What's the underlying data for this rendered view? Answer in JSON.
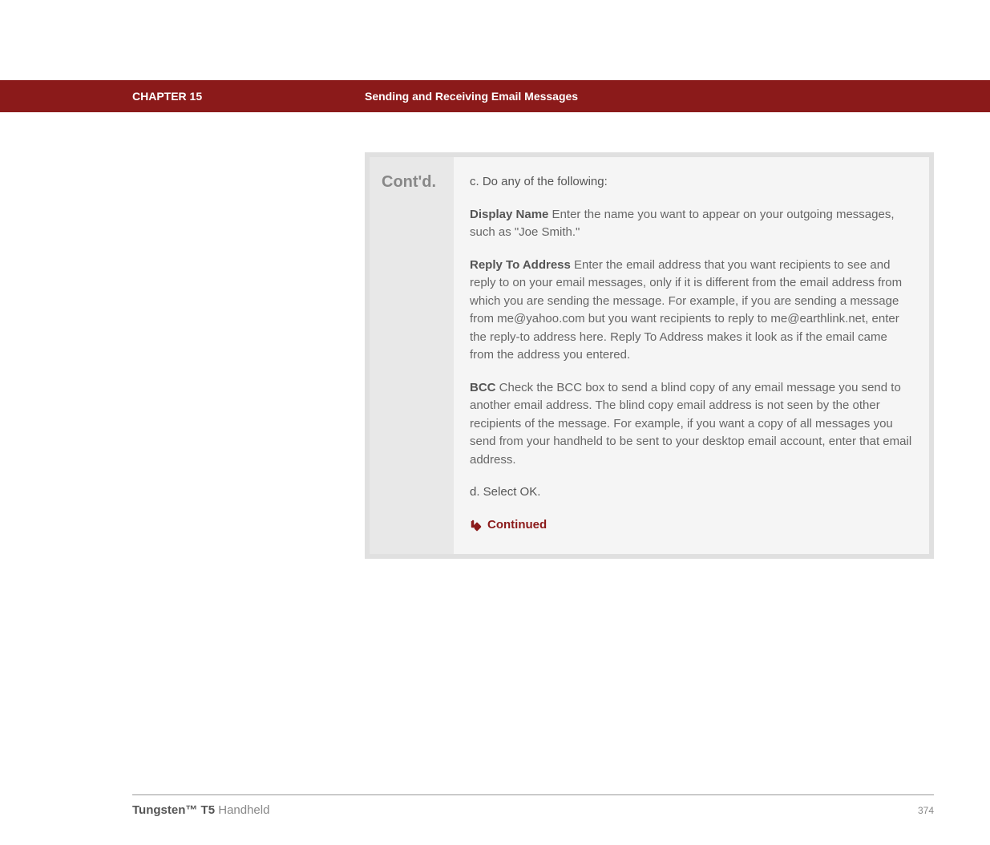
{
  "header": {
    "chapter": "CHAPTER 15",
    "section": "Sending and Receiving Email Messages"
  },
  "step": {
    "label": "Cont'd."
  },
  "content": {
    "item_c": "c.  Do any of the following:",
    "display_name_label": "Display Name",
    "display_name_text": "   Enter the name you want to appear on your outgoing messages, such as \"Joe Smith.\"",
    "reply_to_label": "Reply To Address",
    "reply_to_text": "   Enter the email address that you want recipients to see and reply to on your email messages, only if it is different from the email address from which you are sending the message. For example, if you are sending a message from me@yahoo.com but you want recipients to reply to me@earthlink.net, enter the reply-to address here. Reply To Address makes it look as if the email came from the address you entered.",
    "bcc_label": "BCC",
    "bcc_text": "   Check the BCC box to send a blind copy of any email message you send to another email address. The blind copy email address is not seen by the other recipients of the message. For example, if you want a copy of all messages you send from your handheld to be sent to your desktop email account, enter that email address.",
    "item_d": "d.  Select OK.",
    "continued": "Continued"
  },
  "footer": {
    "product_bold": "Tungsten™ T5",
    "product_rest": " Handheld",
    "page": "374"
  }
}
